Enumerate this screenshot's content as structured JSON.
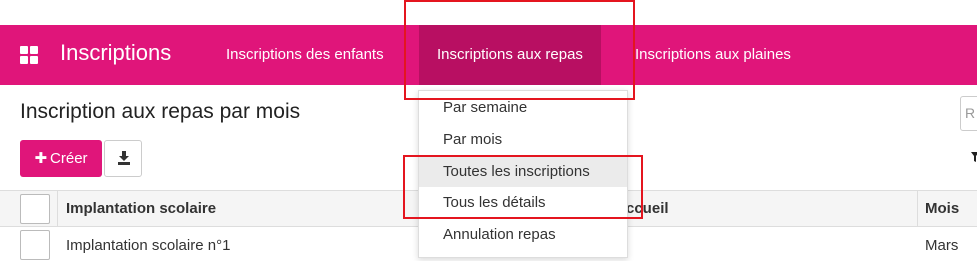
{
  "navbar": {
    "brand": "Inscriptions",
    "items": [
      {
        "label": "Inscriptions des enfants"
      },
      {
        "label": "Inscriptions aux repas"
      },
      {
        "label": "Inscriptions aux plaines"
      }
    ],
    "accent_color": "#e0157a",
    "active_color": "#b80f62"
  },
  "page": {
    "title": "Inscription aux repas par mois",
    "create_label": "Créer",
    "search_placeholder": "R"
  },
  "dropdown": {
    "items": [
      {
        "label": "Par semaine"
      },
      {
        "label": "Par mois"
      },
      {
        "label": "Toutes les inscriptions"
      },
      {
        "label": "Tous les détails"
      },
      {
        "label": "Annulation repas"
      }
    ]
  },
  "table": {
    "columns": [
      {
        "label": "Implantation scolaire"
      },
      {
        "label": "ccueil"
      },
      {
        "label": "Mois"
      }
    ],
    "rows": [
      {
        "school": "Implantation scolaire n°1",
        "month": "Mars"
      }
    ]
  },
  "annotation_color": "#e4151f"
}
